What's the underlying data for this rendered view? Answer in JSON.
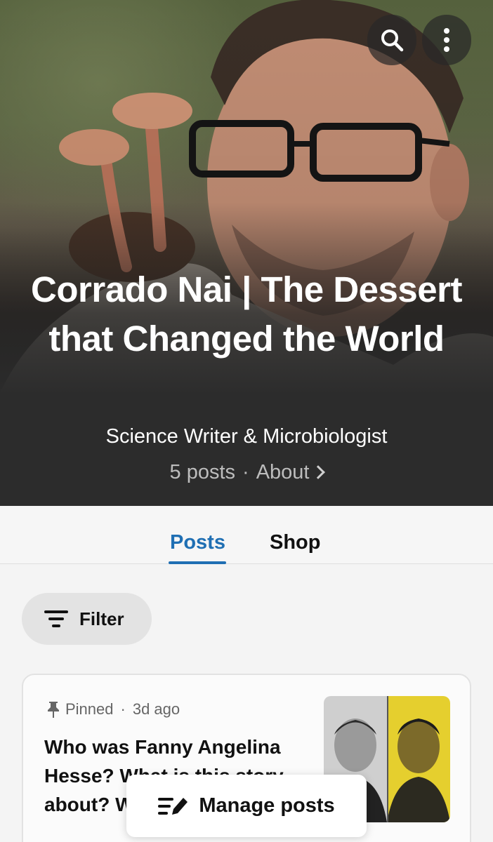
{
  "header": {
    "search_icon": "search-icon",
    "more_icon": "more-vertical-icon"
  },
  "hero": {
    "title": "Corrado Nai  |  The Dessert that Changed the World",
    "subtitle": "Science Writer & Microbiologist",
    "posts_count": "5 posts",
    "separator": "·",
    "about_label": "About"
  },
  "tabs": [
    {
      "label": "Posts",
      "active": true
    },
    {
      "label": "Shop",
      "active": false
    }
  ],
  "filter": {
    "label": "Filter"
  },
  "posts": [
    {
      "pinned_label": "Pinned",
      "separator": "·",
      "age": "3d ago",
      "title": "Who was Fanny Angelina Hesse? What is this story about? W"
    }
  ],
  "manage": {
    "label": "Manage posts"
  },
  "colors": {
    "accent": "#1f6fb3",
    "hero_bg": "#2c2c2c",
    "page_bg": "#f4f4f4"
  }
}
